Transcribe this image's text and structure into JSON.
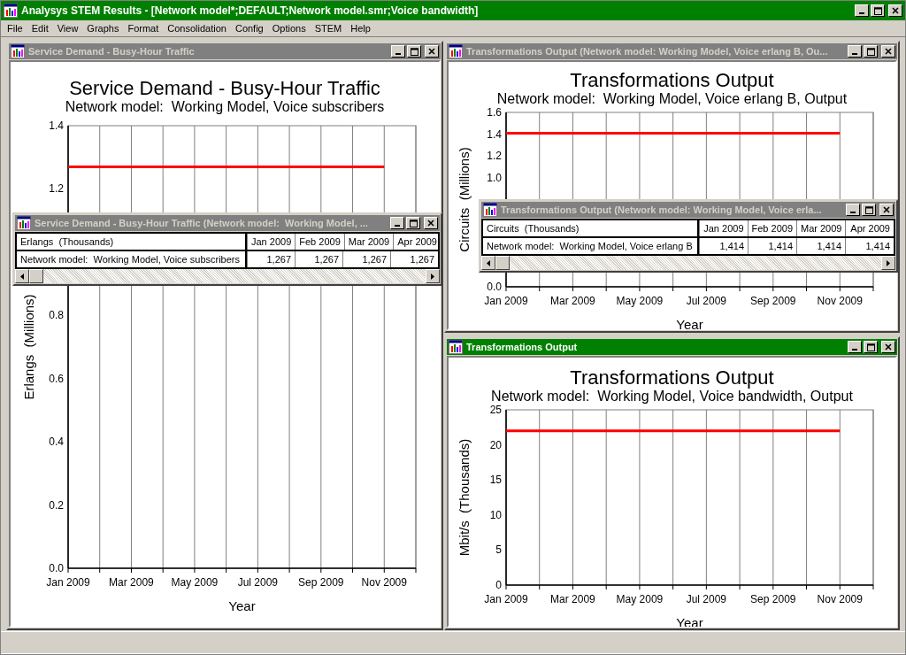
{
  "app": {
    "title": "Analysys STEM Results - [Network model*;DEFAULT;Network model.smr;Voice bandwidth]"
  },
  "menu": [
    "File",
    "Edit",
    "View",
    "Graphs",
    "Format",
    "Consolidation",
    "Config",
    "Options",
    "STEM",
    "Help"
  ],
  "windows": [
    {
      "title": "Service Demand - Busy-Hour Traffic",
      "active": false,
      "chart_subtitle": "Network model:  Working Model, Voice subscribers",
      "chart_data": {
        "type": "line",
        "title": "Service Demand - Busy-Hour Traffic",
        "xlabel": "Year",
        "ylabel": "Erlangs  (Millions)",
        "grid": true,
        "ylim": [
          0,
          1.4
        ],
        "categories": [
          "Jan 2009",
          "Mar 2009",
          "May 2009",
          "Jul 2009",
          "Sep 2009",
          "Nov 2009"
        ],
        "yticks": [
          {
            "value": 0,
            "label": "0.0"
          },
          {
            "value": 0.2,
            "label": "0.2"
          },
          {
            "value": 0.4,
            "label": "0.4"
          },
          {
            "value": 0.6,
            "label": "0.6"
          },
          {
            "value": 0.8,
            "label": "0.8"
          },
          {
            "value": 1.2,
            "label": "1.2"
          },
          {
            "value": 1.4,
            "label": "1.4"
          }
        ],
        "series": [
          {
            "color": "#ff0000",
            "values": [
              1.27,
              1.27,
              1.27,
              1.27,
              1.27,
              1.27
            ]
          }
        ]
      },
      "table_window": {
        "title": "Service Demand - Busy-Hour Traffic (Network model:  Working Model, ...",
        "active": false,
        "columns": [
          "Erlangs  (Thousands)",
          "Jan 2009",
          "Feb 2009",
          "Mar 2009",
          "Apr 2009"
        ],
        "rows": [
          {
            "cells": [
              "Network model:  Working Model, Voice subscribers",
              "1,267",
              "1,267",
              "1,267",
              "1,267"
            ]
          }
        ]
      }
    },
    {
      "title": "Transformations Output (Network model: Working Model, Voice erlang B, Ou...",
      "active": false,
      "chart_subtitle": "Network model:  Working Model, Voice erlang B, Output",
      "chart_data": {
        "type": "line",
        "title": "Transformations Output",
        "xlabel": "Year",
        "ylabel": "Circuits  (Millions)",
        "grid": true,
        "ylim": [
          0,
          1.6
        ],
        "categories": [
          "Jan 2009",
          "Mar 2009",
          "May 2009",
          "Jul 2009",
          "Sep 2009",
          "Nov 2009"
        ],
        "yticks": [
          {
            "value": 0,
            "label": "0.0"
          },
          {
            "value": 1.0,
            "label": "1.0"
          },
          {
            "value": 1.2,
            "label": "1.2"
          },
          {
            "value": 1.4,
            "label": "1.4"
          },
          {
            "value": 1.6,
            "label": "1.6"
          }
        ],
        "series": [
          {
            "color": "#ff0000",
            "values": [
              1.41,
              1.41,
              1.41,
              1.41,
              1.41,
              1.41
            ]
          }
        ]
      },
      "table_window": {
        "title": "Transformations Output (Network model: Working Model, Voice erla...",
        "active": false,
        "columns": [
          "Circuits  (Thousands)",
          "Jan 2009",
          "Feb 2009",
          "Mar 2009",
          "Apr 2009"
        ],
        "rows": [
          {
            "cells": [
              "Network model:  Working Model, Voice erlang B",
              "1,414",
              "1,414",
              "1,414",
              "1,414"
            ]
          }
        ]
      }
    },
    {
      "title": "Transformations Output",
      "active": true,
      "chart_subtitle": "Network model:  Working Model, Voice bandwidth, Output",
      "chart_data": {
        "type": "line",
        "title": "Transformations Output",
        "xlabel": "Year",
        "ylabel": "Mbit/s  (Thousands)",
        "grid": true,
        "ylim": [
          0,
          25
        ],
        "categories": [
          "Jan 2009",
          "Mar 2009",
          "May 2009",
          "Jul 2009",
          "Sep 2009",
          "Nov 2009"
        ],
        "yticks": [
          {
            "value": 0,
            "label": "0"
          },
          {
            "value": 5,
            "label": "5"
          },
          {
            "value": 10,
            "label": "10"
          },
          {
            "value": 15,
            "label": "15"
          },
          {
            "value": 20,
            "label": "20"
          },
          {
            "value": 25,
            "label": "25"
          }
        ],
        "series": [
          {
            "color": "#ff0000",
            "values": [
              22,
              22,
              22,
              22,
              22,
              22
            ]
          }
        ]
      }
    }
  ]
}
